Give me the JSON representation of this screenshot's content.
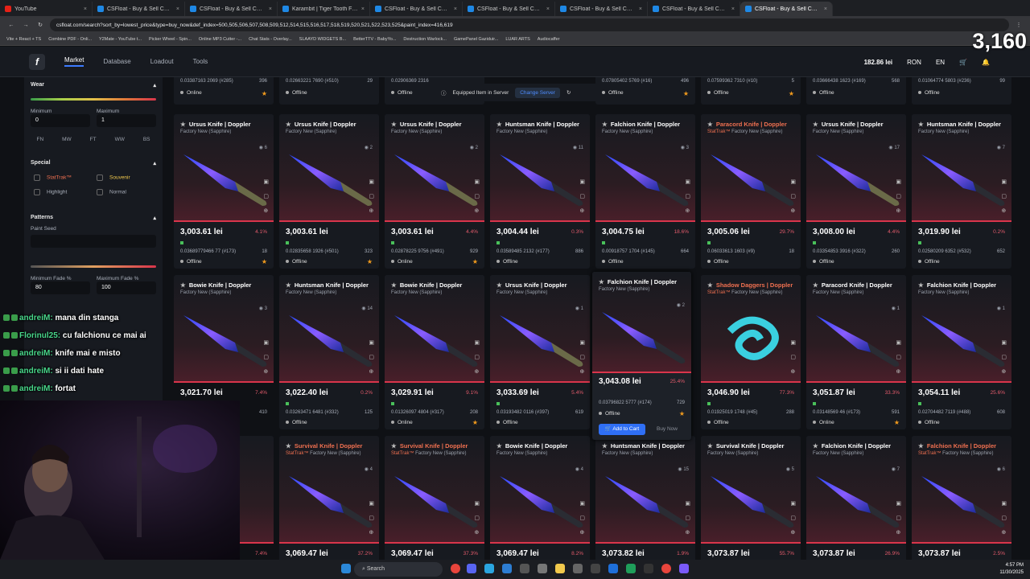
{
  "browser": {
    "tabs": [
      {
        "title": "YouTube",
        "icon": "youtube-icon"
      },
      {
        "title": "CSFloat - Buy & Sell CS2 Skins"
      },
      {
        "title": "CSFloat - Buy & Sell CS2 Skins"
      },
      {
        "title": "Karambit | Tiger Tooth Factory"
      },
      {
        "title": "CSFloat - Buy & Sell CS2 Skins"
      },
      {
        "title": "CSFloat - Buy & Sell CS2 Skins"
      },
      {
        "title": "CSFloat - Buy & Sell CS2 Skins"
      },
      {
        "title": "CSFloat - Buy & Sell CS2 Skins"
      },
      {
        "title": "CSFloat - Buy & Sell CS2 Skins"
      }
    ],
    "url": "csfloat.com/search?sort_by=lowest_price&type=buy_now&def_index=500,505,506,507,508,509,512,514,515,516,517,518,519,520,521,522,523,525&paint_index=416,619",
    "bookmarks": [
      "Vite + React + TS",
      "Combine PDF - Onli...",
      "Y2Mate - YouTube t...",
      "Picker Wheel - Spin...",
      "Online MP3 Cutter -...",
      "Chat Stats - Overlay...",
      "SLAAYD WIDGETS B...",
      "BetterTTV - BabyYo...",
      "Destruction Warlock...",
      "GamePanel Gaziduir...",
      "LUAR ARTS",
      "Audiocaffer"
    ]
  },
  "nav": {
    "market": "Market",
    "database": "Database",
    "loadout": "Loadout",
    "tools": "Tools",
    "balance": "182.86 lei",
    "currency": "RON",
    "language": "EN",
    "overlay_count": "3,160"
  },
  "sidebar": {
    "wear_title": "Wear",
    "minimum_label": "Minimum",
    "maximum_label": "Maximum",
    "minimum_value": "0",
    "maximum_value": "1",
    "wears": [
      "FN",
      "MW",
      "FT",
      "WW",
      "BS"
    ],
    "special_title": "Special",
    "stattrak": "StatTrak™",
    "souvenir": "Souvenir",
    "highlight": "Highlight",
    "normal": "Normal",
    "patterns_title": "Patterns",
    "paint_seed": "Paint Seed",
    "min_fade_label": "Minimum Fade %",
    "max_fade_label": "Maximum Fade %",
    "min_fade": "80",
    "max_fade": "100"
  },
  "server": {
    "label": "Equipped Item in Server",
    "change": "Change Server"
  },
  "top_strip": [
    {
      "float": "0.03387163 2069 (#285)",
      "seed": "396",
      "status": "Online"
    },
    {
      "float": "0.02663221 7690 (#510)",
      "seed": "29",
      "status": "Offline"
    },
    {
      "float": "0.02906369 2316",
      "seed": "",
      "status": "Offline"
    },
    {
      "float": "",
      "seed": "",
      "status": ""
    },
    {
      "float": "0.07805402 5769 (#16)",
      "seed": "496",
      "status": "Offline"
    },
    {
      "float": "0.07599362 7310 (#10)",
      "seed": "5",
      "status": "Offline"
    },
    {
      "float": "0.03666438 1623 (#169)",
      "seed": "568",
      "status": "Offline"
    },
    {
      "float": "0.01064774 5803 (#236)",
      "seed": "99",
      "status": "Offline"
    }
  ],
  "cards": [
    {
      "name": "Ursus Knife | Doppler",
      "sub": "Factory New (Sapphire)",
      "watch": "6",
      "price": "3,003.61 lei",
      "pct": "4.1%",
      "float": "0.03689779466 77 (#173)",
      "seed": "18",
      "status": "Offline",
      "fav": true
    },
    {
      "name": "Ursus Knife | Doppler",
      "sub": "Factory New (Sapphire)",
      "watch": "2",
      "price": "3,003.61 lei",
      "pct": "",
      "float": "0.02835658 1926 (#501)",
      "seed": "323",
      "status": "Offline",
      "fav": true
    },
    {
      "name": "Ursus Knife | Doppler",
      "sub": "Factory New (Sapphire)",
      "watch": "2",
      "price": "3,003.61 lei",
      "pct": "4.4%",
      "float": "0.02878225 9756 (#491)",
      "seed": "929",
      "status": "Online",
      "fav": true
    },
    {
      "name": "Huntsman Knife | Doppler",
      "sub": "Factory New (Sapphire)",
      "watch": "11",
      "price": "3,004.44 lei",
      "pct": "0.3%",
      "float": "0.03589485 2132 (#177)",
      "seed": "886",
      "status": "Offline",
      "fav": false
    },
    {
      "name": "Falchion Knife | Doppler",
      "sub": "Factory New (Sapphire)",
      "watch": "3",
      "price": "3,004.75 lei",
      "pct": "18.6%",
      "float": "0.00918757 1704 (#145)",
      "seed": "664",
      "status": "Offline",
      "fav": false
    },
    {
      "name": "Paracord Knife | Doppler",
      "sub": "Factory New (Sapphire)",
      "watch": "",
      "price": "3,005.06 lei",
      "pct": "29.7%",
      "float": "0.06033613 1603 (#9)",
      "seed": "18",
      "status": "Offline",
      "fav": false,
      "stattrak": true
    },
    {
      "name": "Ursus Knife | Doppler",
      "sub": "Factory New (Sapphire)",
      "watch": "17",
      "price": "3,008.00 lei",
      "pct": "4.4%",
      "float": "0.03354853 3916 (#322)",
      "seed": "260",
      "status": "Offline",
      "fav": false
    },
    {
      "name": "Huntsman Knife | Doppler",
      "sub": "Factory New (Sapphire)",
      "watch": "7",
      "price": "3,019.90 lei",
      "pct": "0.2%",
      "float": "0.02580209 6352 (#532)",
      "seed": "652",
      "status": "Offline",
      "fav": false
    },
    {
      "name": "Bowie Knife | Doppler",
      "sub": "Factory New (Sapphire)",
      "watch": "3",
      "price": "3,021.70 lei",
      "pct": "7.4%",
      "float": "",
      "seed": "410",
      "status": "",
      "fav": false
    },
    {
      "name": "Huntsman Knife | Doppler",
      "sub": "Factory New (Sapphire)",
      "watch": "14",
      "price": "3,022.40 lei",
      "pct": "0.2%",
      "float": "0.03263471 6481 (#332)",
      "seed": "125",
      "status": "Offline",
      "fav": false
    },
    {
      "name": "Bowie Knife | Doppler",
      "sub": "Factory New (Sapphire)",
      "watch": "",
      "price": "3,029.91 lei",
      "pct": "9.1%",
      "float": "0.01326097 4804 (#317)",
      "seed": "208",
      "status": "Online",
      "fav": true
    },
    {
      "name": "Ursus Knife | Doppler",
      "sub": "Factory New (Sapphire)",
      "watch": "1",
      "price": "3,033.69 lei",
      "pct": "5.4%",
      "float": "0.03193482 0116 (#397)",
      "seed": "619",
      "status": "Offline",
      "fav": false
    },
    {
      "name": "Falchion Knife | Doppler",
      "sub": "Factory New (Sapphire)",
      "watch": "2",
      "price": "3,043.08 lei",
      "pct": "25.4%",
      "float": "0.03796822 5777 (#174)",
      "seed": "729",
      "status": "Offline",
      "fav": true,
      "hover": true
    },
    {
      "name": "Shadow Daggers | Doppler",
      "sub": "Factory New (Sapphire)",
      "watch": "",
      "price": "3,046.90 lei",
      "pct": "77.3%",
      "float": "0.01925019 1748 (#45)",
      "seed": "288",
      "status": "Offline",
      "fav": false,
      "stattrak": true
    },
    {
      "name": "Paracord Knife | Doppler",
      "sub": "Factory New (Sapphire)",
      "watch": "1",
      "price": "3,051.87 lei",
      "pct": "33.3%",
      "float": "0.03148569 46 (#173)",
      "seed": "591",
      "status": "Online",
      "fav": true
    },
    {
      "name": "Falchion Knife | Doppler",
      "sub": "Factory New (Sapphire)",
      "watch": "1",
      "price": "3,054.11 lei",
      "pct": "25.6%",
      "float": "0.02704482 7119 (#488)",
      "seed": "608",
      "status": "Offline",
      "fav": false
    },
    {
      "name": "",
      "sub": "",
      "watch": "",
      "price": "",
      "pct": "7.4%",
      "float": "",
      "seed": "",
      "status": "",
      "fav": false
    },
    {
      "name": "Survival Knife | Doppler",
      "sub": "Factory New (Sapphire)",
      "watch": "4",
      "price": "3,069.47 lei",
      "pct": "37.2%",
      "float": "",
      "seed": "",
      "status": "",
      "fav": false,
      "stattrak": true
    },
    {
      "name": "Survival Knife | Doppler",
      "sub": "Factory New (Sapphire)",
      "watch": "",
      "price": "3,069.47 lei",
      "pct": "37.3%",
      "float": "",
      "seed": "",
      "status": "",
      "fav": false,
      "stattrak": true
    },
    {
      "name": "Bowie Knife | Doppler",
      "sub": "Factory New (Sapphire)",
      "watch": "4",
      "price": "3,069.47 lei",
      "pct": "8.2%",
      "float": "",
      "seed": "",
      "status": "",
      "fav": false
    },
    {
      "name": "Huntsman Knife | Doppler",
      "sub": "Factory New (Sapphire)",
      "watch": "15",
      "price": "3,073.82 lei",
      "pct": "1.9%",
      "float": "",
      "seed": "",
      "status": "",
      "fav": false
    },
    {
      "name": "Survival Knife | Doppler",
      "sub": "Factory New (Sapphire)",
      "watch": "5",
      "price": "3,073.87 lei",
      "pct": "55.7%",
      "float": "",
      "seed": "",
      "status": "",
      "fav": false
    },
    {
      "name": "Falchion Knife | Doppler",
      "sub": "Factory New (Sapphire)",
      "watch": "7",
      "price": "3,073.87 lei",
      "pct": "26.9%",
      "float": "",
      "seed": "",
      "status": "",
      "fav": false
    },
    {
      "name": "Falchion Knife | Doppler",
      "sub": "Factory New (Sapphire)",
      "watch": "6",
      "price": "3,073.87 lei",
      "pct": "2.5%",
      "float": "",
      "seed": "",
      "status": "",
      "fav": false,
      "stattrak": true
    }
  ],
  "hover_actions": {
    "add_to_cart": "Add to Cart",
    "buy_now": "Buy Now"
  },
  "stattrak_label": "StatTrak™",
  "chat": [
    {
      "user": "andreiM:",
      "msg": "mana din stanga"
    },
    {
      "user": "Florinul25:",
      "msg": "cu falchionu ce mai ai"
    },
    {
      "user": "andreiM:",
      "msg": "knife mai e misto"
    },
    {
      "user": "andreiM:",
      "msg": "si ii dati hate"
    },
    {
      "user": "andreiM:",
      "msg": "fortat"
    }
  ],
  "taskbar": {
    "search": "Search",
    "time": "4:57 PM",
    "date": "11/30/2025"
  }
}
